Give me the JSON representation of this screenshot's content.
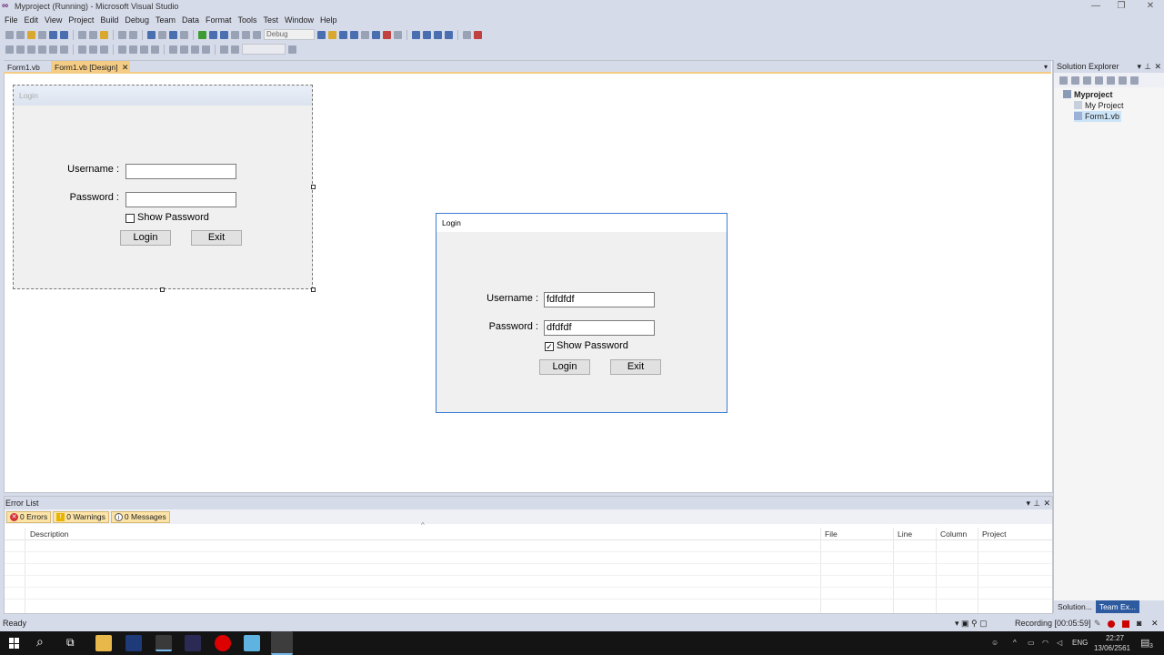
{
  "window": {
    "title": "Myproject (Running) - Microsoft Visual Studio"
  },
  "menu": [
    "File",
    "Edit",
    "View",
    "Project",
    "Build",
    "Debug",
    "Team",
    "Data",
    "Format",
    "Tools",
    "Test",
    "Window",
    "Help"
  ],
  "toolbar": {
    "config": "Debug"
  },
  "tabs": [
    {
      "label": "Form1.vb"
    },
    {
      "label": "Form1.vb [Design]"
    }
  ],
  "designer_form": {
    "title": "Login",
    "username_label": "Username :",
    "password_label": "Password :",
    "show_password": "Show Password",
    "login_button": "Login",
    "exit_button": "Exit"
  },
  "running_form": {
    "title": "Login",
    "username_label": "Username :",
    "username_value": "fdfdfdf",
    "password_label": "Password :",
    "password_value": "dfdfdf",
    "show_password": "Show Password",
    "show_password_checked": true,
    "login_button": "Login",
    "exit_button": "Exit"
  },
  "solution_explorer": {
    "title": "Solution Explorer",
    "project": "Myproject",
    "items": [
      "My Project",
      "Form1.vb"
    ],
    "bottom_tabs": [
      "Solution...",
      "Team Ex..."
    ]
  },
  "error_list": {
    "title": "Error List",
    "filters": {
      "errors": "0 Errors",
      "warnings": "0 Warnings",
      "messages": "0 Messages"
    },
    "columns": [
      "Description",
      "File",
      "Line",
      "Column",
      "Project"
    ]
  },
  "status": {
    "text": "Ready",
    "recording": "Recording [00:05:59]"
  },
  "tray": {
    "lang": "ENG",
    "time": "22:27",
    "date": "13/06/2561",
    "notifications": "3"
  },
  "colors": {
    "accent": "#f5cc84",
    "titlebar": "#d6dbe9",
    "running_border": "#3a7cd6"
  }
}
